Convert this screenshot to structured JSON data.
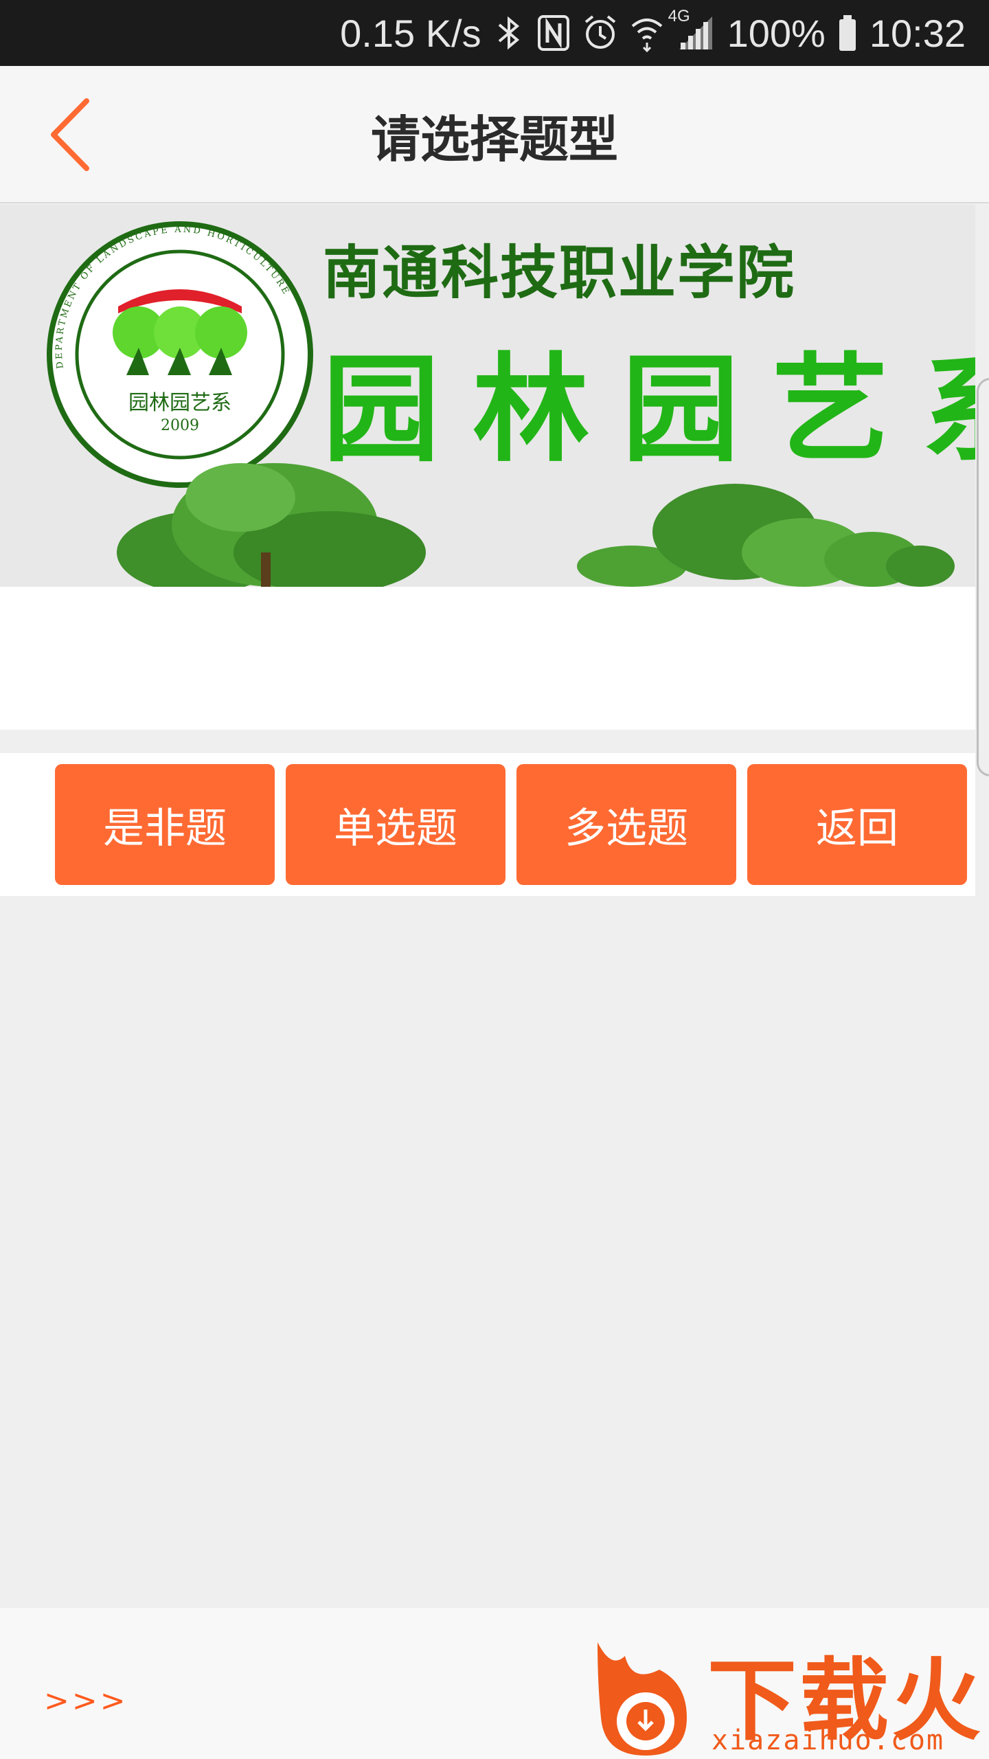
{
  "status_bar": {
    "speed": "0.15 K/s",
    "network": "4G",
    "battery": "100%",
    "time": "10:32"
  },
  "header": {
    "title": "请选择题型"
  },
  "banner": {
    "school_name": "南通科技职业学院",
    "department": "园林园艺系",
    "logo_text": "园林园艺系",
    "logo_year": "2009",
    "logo_ring_text": "DEPARTMENT OF LANDSCAPE AND HORTICULTURE"
  },
  "buttons": [
    {
      "label": "是非题"
    },
    {
      "label": "单选题"
    },
    {
      "label": "多选题"
    },
    {
      "label": "返回"
    }
  ],
  "footer": {
    "more_link": ">>>",
    "ad_brand": "下载火",
    "ad_url": "xiazaihuo.com"
  },
  "colors": {
    "accent": "#ff6a33",
    "brand_green_dark": "#1f6b14",
    "brand_green": "#22b517"
  }
}
